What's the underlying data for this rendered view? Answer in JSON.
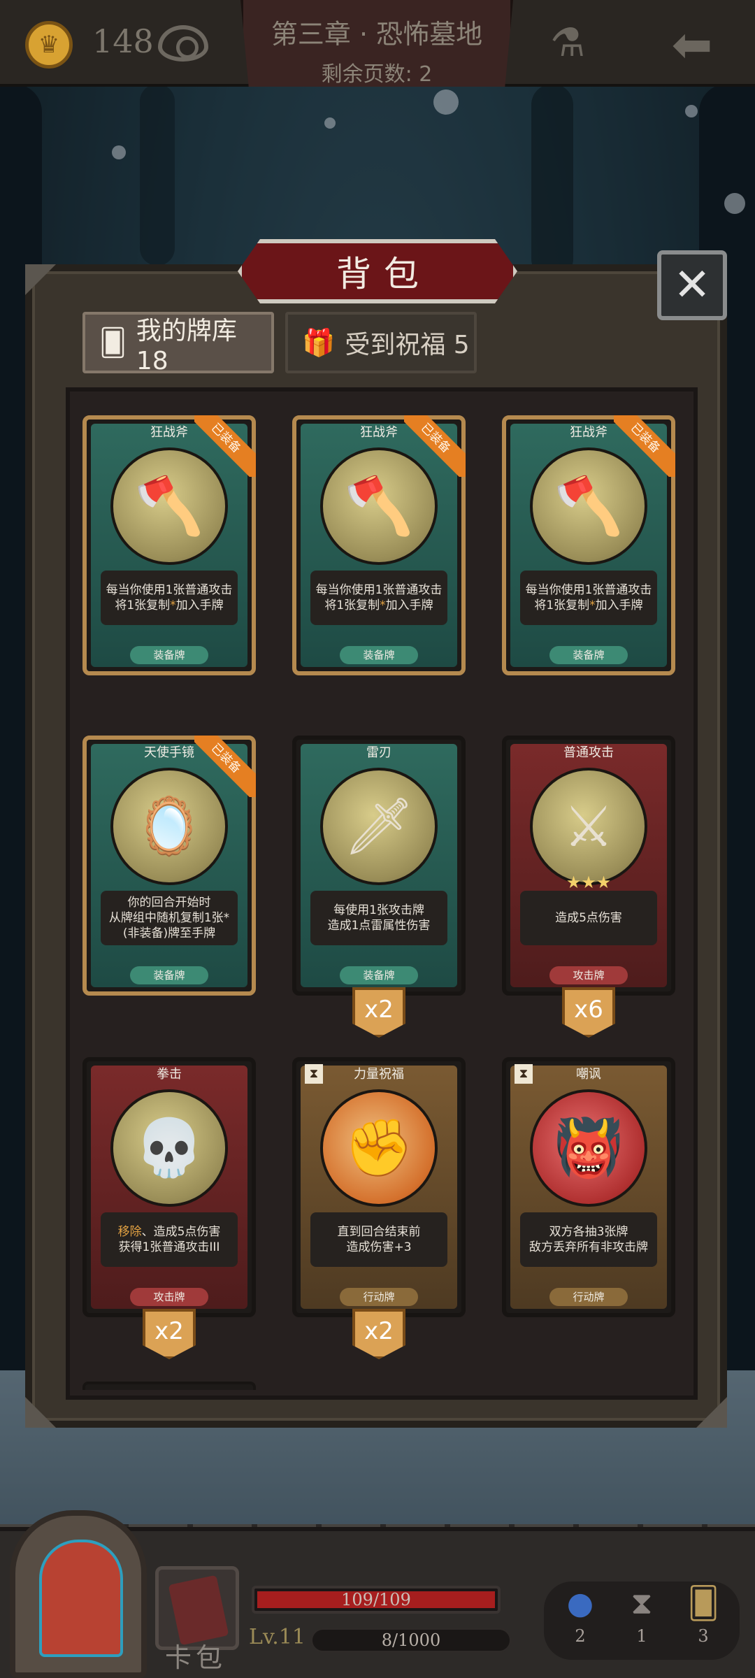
{
  "topbar": {
    "coin_count": "148",
    "chapter_title": "第三章 · 恐怖墓地",
    "pages_left": "剩余页数: 2"
  },
  "bag": {
    "title": "背包",
    "tabs": [
      {
        "label": "我的牌库 18",
        "active": true
      },
      {
        "label": "受到祝福 5",
        "active": false
      }
    ],
    "equip_tag": "已装备",
    "cards": [
      {
        "name": "狂战斧",
        "desc1": "每当你使用1张普通攻击",
        "desc2a": "将1张复制",
        "desc2b": "*",
        "desc2c": "加入手牌",
        "type": "装备牌",
        "equipped": true,
        "count": ""
      },
      {
        "name": "狂战斧",
        "desc1": "每当你使用1张普通攻击",
        "desc2a": "将1张复制",
        "desc2b": "*",
        "desc2c": "加入手牌",
        "type": "装备牌",
        "equipped": true,
        "count": ""
      },
      {
        "name": "狂战斧",
        "desc1": "每当你使用1张普通攻击",
        "desc2a": "将1张复制",
        "desc2b": "*",
        "desc2c": "加入手牌",
        "type": "装备牌",
        "equipped": true,
        "count": ""
      },
      {
        "name": "天使手镜",
        "desc1": "你的回合开始时",
        "desc2": "从牌组中随机复制1张*",
        "desc3": "(非装备)牌至手牌",
        "type": "装备牌",
        "equipped": true,
        "count": ""
      },
      {
        "name": "雷刃",
        "desc1": "每使用1张攻击牌",
        "desc2": "造成1点雷属性伤害",
        "type": "装备牌",
        "equipped": false,
        "count": "x2"
      },
      {
        "name": "普通攻击",
        "desc1": "造成5点伤害",
        "type": "攻击牌",
        "equipped": false,
        "count": "x6"
      },
      {
        "name": "拳击",
        "desc1a": "移除",
        "desc1b": "、造成5点伤害",
        "desc2": "获得1张普通攻击III",
        "type": "攻击牌",
        "equipped": false,
        "count": "x2"
      },
      {
        "name": "力量祝福",
        "desc1": "直到回合结束前",
        "desc2": "造成伤害+3",
        "type": "行动牌",
        "equipped": false,
        "count": "x2"
      },
      {
        "name": "嘲讽",
        "desc1": "双方各抽3张牌",
        "desc2": "敌方丢弃所有非攻击牌",
        "type": "行动牌",
        "equipped": false,
        "count": ""
      }
    ]
  },
  "bottombar": {
    "cardpack_label": "卡包",
    "level": "Lv.11",
    "hp": {
      "current": 109,
      "max": 109,
      "text": "109/109"
    },
    "xp": {
      "current": 8,
      "max": 1000,
      "text": "8/1000"
    },
    "resources": [
      {
        "icon": "orb-icon",
        "count": "2"
      },
      {
        "icon": "hourglass-icon",
        "count": "1"
      },
      {
        "icon": "cards-icon",
        "count": "3"
      }
    ]
  },
  "colors": {
    "equip_orange": "#e57f22",
    "hp_red": "#a61e1e",
    "banner_red": "#6b1518",
    "badge_gold": "#dba255"
  }
}
